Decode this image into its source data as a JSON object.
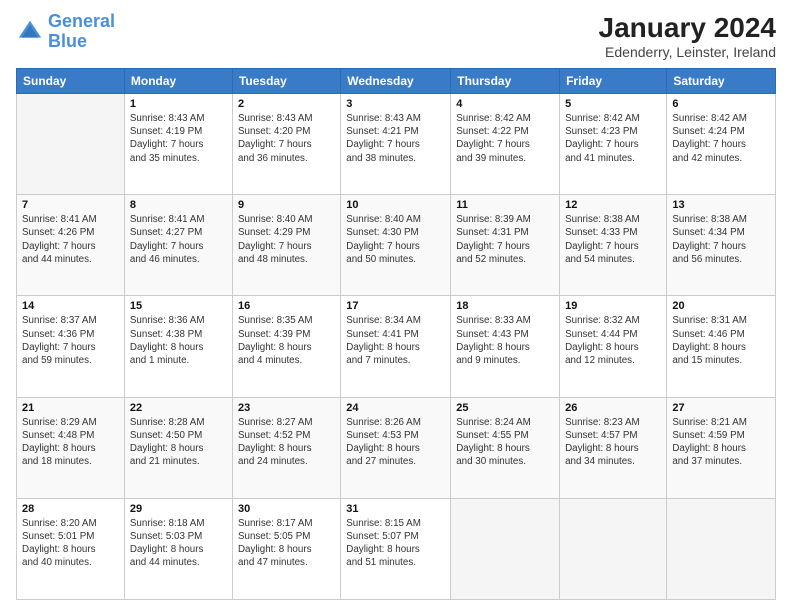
{
  "logo": {
    "line1": "General",
    "line2": "Blue"
  },
  "title": "January 2024",
  "subtitle": "Edenderry, Leinster, Ireland",
  "days_header": [
    "Sunday",
    "Monday",
    "Tuesday",
    "Wednesday",
    "Thursday",
    "Friday",
    "Saturday"
  ],
  "weeks": [
    [
      {
        "day": "",
        "info": ""
      },
      {
        "day": "1",
        "info": "Sunrise: 8:43 AM\nSunset: 4:19 PM\nDaylight: 7 hours\nand 35 minutes."
      },
      {
        "day": "2",
        "info": "Sunrise: 8:43 AM\nSunset: 4:20 PM\nDaylight: 7 hours\nand 36 minutes."
      },
      {
        "day": "3",
        "info": "Sunrise: 8:43 AM\nSunset: 4:21 PM\nDaylight: 7 hours\nand 38 minutes."
      },
      {
        "day": "4",
        "info": "Sunrise: 8:42 AM\nSunset: 4:22 PM\nDaylight: 7 hours\nand 39 minutes."
      },
      {
        "day": "5",
        "info": "Sunrise: 8:42 AM\nSunset: 4:23 PM\nDaylight: 7 hours\nand 41 minutes."
      },
      {
        "day": "6",
        "info": "Sunrise: 8:42 AM\nSunset: 4:24 PM\nDaylight: 7 hours\nand 42 minutes."
      }
    ],
    [
      {
        "day": "7",
        "info": "Sunrise: 8:41 AM\nSunset: 4:26 PM\nDaylight: 7 hours\nand 44 minutes."
      },
      {
        "day": "8",
        "info": "Sunrise: 8:41 AM\nSunset: 4:27 PM\nDaylight: 7 hours\nand 46 minutes."
      },
      {
        "day": "9",
        "info": "Sunrise: 8:40 AM\nSunset: 4:29 PM\nDaylight: 7 hours\nand 48 minutes."
      },
      {
        "day": "10",
        "info": "Sunrise: 8:40 AM\nSunset: 4:30 PM\nDaylight: 7 hours\nand 50 minutes."
      },
      {
        "day": "11",
        "info": "Sunrise: 8:39 AM\nSunset: 4:31 PM\nDaylight: 7 hours\nand 52 minutes."
      },
      {
        "day": "12",
        "info": "Sunrise: 8:38 AM\nSunset: 4:33 PM\nDaylight: 7 hours\nand 54 minutes."
      },
      {
        "day": "13",
        "info": "Sunrise: 8:38 AM\nSunset: 4:34 PM\nDaylight: 7 hours\nand 56 minutes."
      }
    ],
    [
      {
        "day": "14",
        "info": "Sunrise: 8:37 AM\nSunset: 4:36 PM\nDaylight: 7 hours\nand 59 minutes."
      },
      {
        "day": "15",
        "info": "Sunrise: 8:36 AM\nSunset: 4:38 PM\nDaylight: 8 hours\nand 1 minute."
      },
      {
        "day": "16",
        "info": "Sunrise: 8:35 AM\nSunset: 4:39 PM\nDaylight: 8 hours\nand 4 minutes."
      },
      {
        "day": "17",
        "info": "Sunrise: 8:34 AM\nSunset: 4:41 PM\nDaylight: 8 hours\nand 7 minutes."
      },
      {
        "day": "18",
        "info": "Sunrise: 8:33 AM\nSunset: 4:43 PM\nDaylight: 8 hours\nand 9 minutes."
      },
      {
        "day": "19",
        "info": "Sunrise: 8:32 AM\nSunset: 4:44 PM\nDaylight: 8 hours\nand 12 minutes."
      },
      {
        "day": "20",
        "info": "Sunrise: 8:31 AM\nSunset: 4:46 PM\nDaylight: 8 hours\nand 15 minutes."
      }
    ],
    [
      {
        "day": "21",
        "info": "Sunrise: 8:29 AM\nSunset: 4:48 PM\nDaylight: 8 hours\nand 18 minutes."
      },
      {
        "day": "22",
        "info": "Sunrise: 8:28 AM\nSunset: 4:50 PM\nDaylight: 8 hours\nand 21 minutes."
      },
      {
        "day": "23",
        "info": "Sunrise: 8:27 AM\nSunset: 4:52 PM\nDaylight: 8 hours\nand 24 minutes."
      },
      {
        "day": "24",
        "info": "Sunrise: 8:26 AM\nSunset: 4:53 PM\nDaylight: 8 hours\nand 27 minutes."
      },
      {
        "day": "25",
        "info": "Sunrise: 8:24 AM\nSunset: 4:55 PM\nDaylight: 8 hours\nand 30 minutes."
      },
      {
        "day": "26",
        "info": "Sunrise: 8:23 AM\nSunset: 4:57 PM\nDaylight: 8 hours\nand 34 minutes."
      },
      {
        "day": "27",
        "info": "Sunrise: 8:21 AM\nSunset: 4:59 PM\nDaylight: 8 hours\nand 37 minutes."
      }
    ],
    [
      {
        "day": "28",
        "info": "Sunrise: 8:20 AM\nSunset: 5:01 PM\nDaylight: 8 hours\nand 40 minutes."
      },
      {
        "day": "29",
        "info": "Sunrise: 8:18 AM\nSunset: 5:03 PM\nDaylight: 8 hours\nand 44 minutes."
      },
      {
        "day": "30",
        "info": "Sunrise: 8:17 AM\nSunset: 5:05 PM\nDaylight: 8 hours\nand 47 minutes."
      },
      {
        "day": "31",
        "info": "Sunrise: 8:15 AM\nSunset: 5:07 PM\nDaylight: 8 hours\nand 51 minutes."
      },
      {
        "day": "",
        "info": ""
      },
      {
        "day": "",
        "info": ""
      },
      {
        "day": "",
        "info": ""
      }
    ]
  ]
}
